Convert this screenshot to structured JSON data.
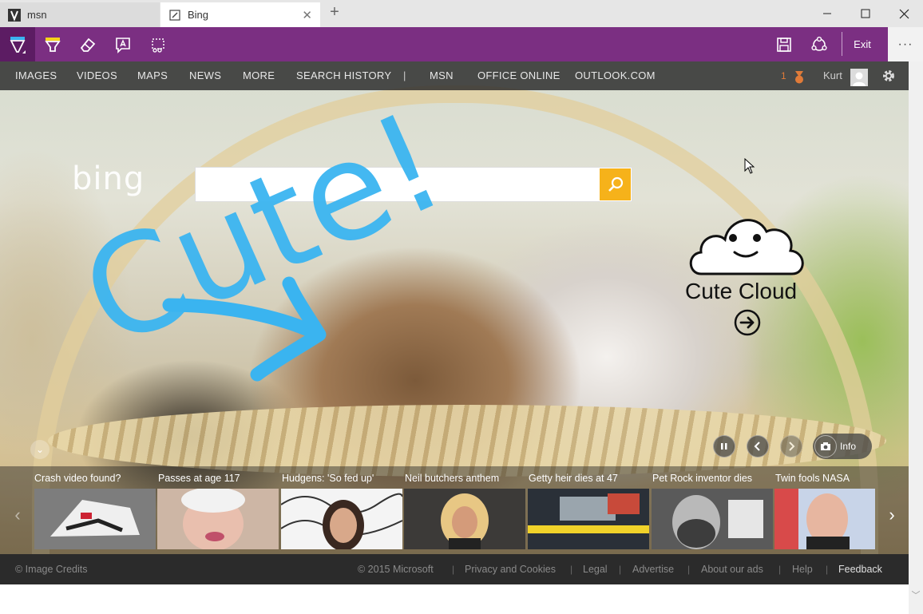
{
  "tabs": [
    {
      "label": "msn"
    },
    {
      "label": "Bing"
    }
  ],
  "ink_toolbar": {
    "exit_label": "Exit",
    "more_label": "···"
  },
  "nav": {
    "items": [
      "IMAGES",
      "VIDEOS",
      "MAPS",
      "NEWS",
      "MORE",
      "SEARCH HISTORY"
    ],
    "pipe": "|",
    "links": [
      "MSN",
      "OFFICE ONLINE",
      "OUTLOOK.COM"
    ],
    "rewards_count": "1",
    "user_name": "Kurt"
  },
  "search": {
    "logo_text": "bing",
    "placeholder": ""
  },
  "promo": {
    "title": "Cute Cloud"
  },
  "ink_text": "Cute!",
  "slideshow": {
    "info_label": "Info"
  },
  "news": [
    {
      "title": "Crash video found?"
    },
    {
      "title": "Passes at age 117"
    },
    {
      "title": "Hudgens: 'So fed up'"
    },
    {
      "title": "Neil butchers anthem"
    },
    {
      "title": "Getty heir dies at 47"
    },
    {
      "title": "Pet Rock inventor dies"
    },
    {
      "title": "Twin fools NASA"
    }
  ],
  "footer": {
    "image_credits": "© Image Credits",
    "links": [
      "© 2015 Microsoft",
      "Privacy and Cookies",
      "Legal",
      "Advertise",
      "About our ads",
      "Help"
    ],
    "feedback": "Feedback",
    "separator": "|"
  },
  "colors": {
    "ink_purple": "#7b2f82",
    "ink_blue": "#3ab4f0",
    "search_yellow": "#f6b21a"
  }
}
